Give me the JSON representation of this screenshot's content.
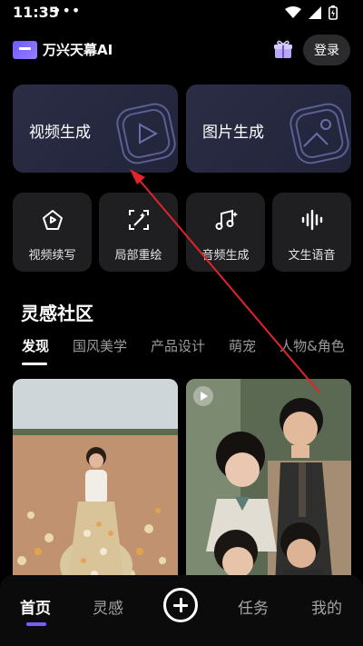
{
  "status_bar": {
    "time": "11:35",
    "dots": "•••"
  },
  "header": {
    "app_name": "万兴天幕AI",
    "login_label": "登录"
  },
  "big_cards": [
    {
      "label": "视频生成",
      "icon": "video-play-icon"
    },
    {
      "label": "图片生成",
      "icon": "image-icon"
    }
  ],
  "tools": [
    {
      "label": "视频续写",
      "icon": "video-continue-icon"
    },
    {
      "label": "局部重绘",
      "icon": "partial-repaint-icon"
    },
    {
      "label": "音频生成",
      "icon": "music-note-icon"
    },
    {
      "label": "文生语音",
      "icon": "voice-wave-icon"
    }
  ],
  "community": {
    "title": "灵感社区",
    "tabs": [
      "发现",
      "国风美学",
      "产品设计",
      "萌宠",
      "人物&角色"
    ]
  },
  "bottom_nav": [
    "首页",
    "灵感",
    "任务",
    "我的"
  ],
  "colors": {
    "accent": "#7c5cff",
    "annotation_arrow": "#e0242a"
  }
}
